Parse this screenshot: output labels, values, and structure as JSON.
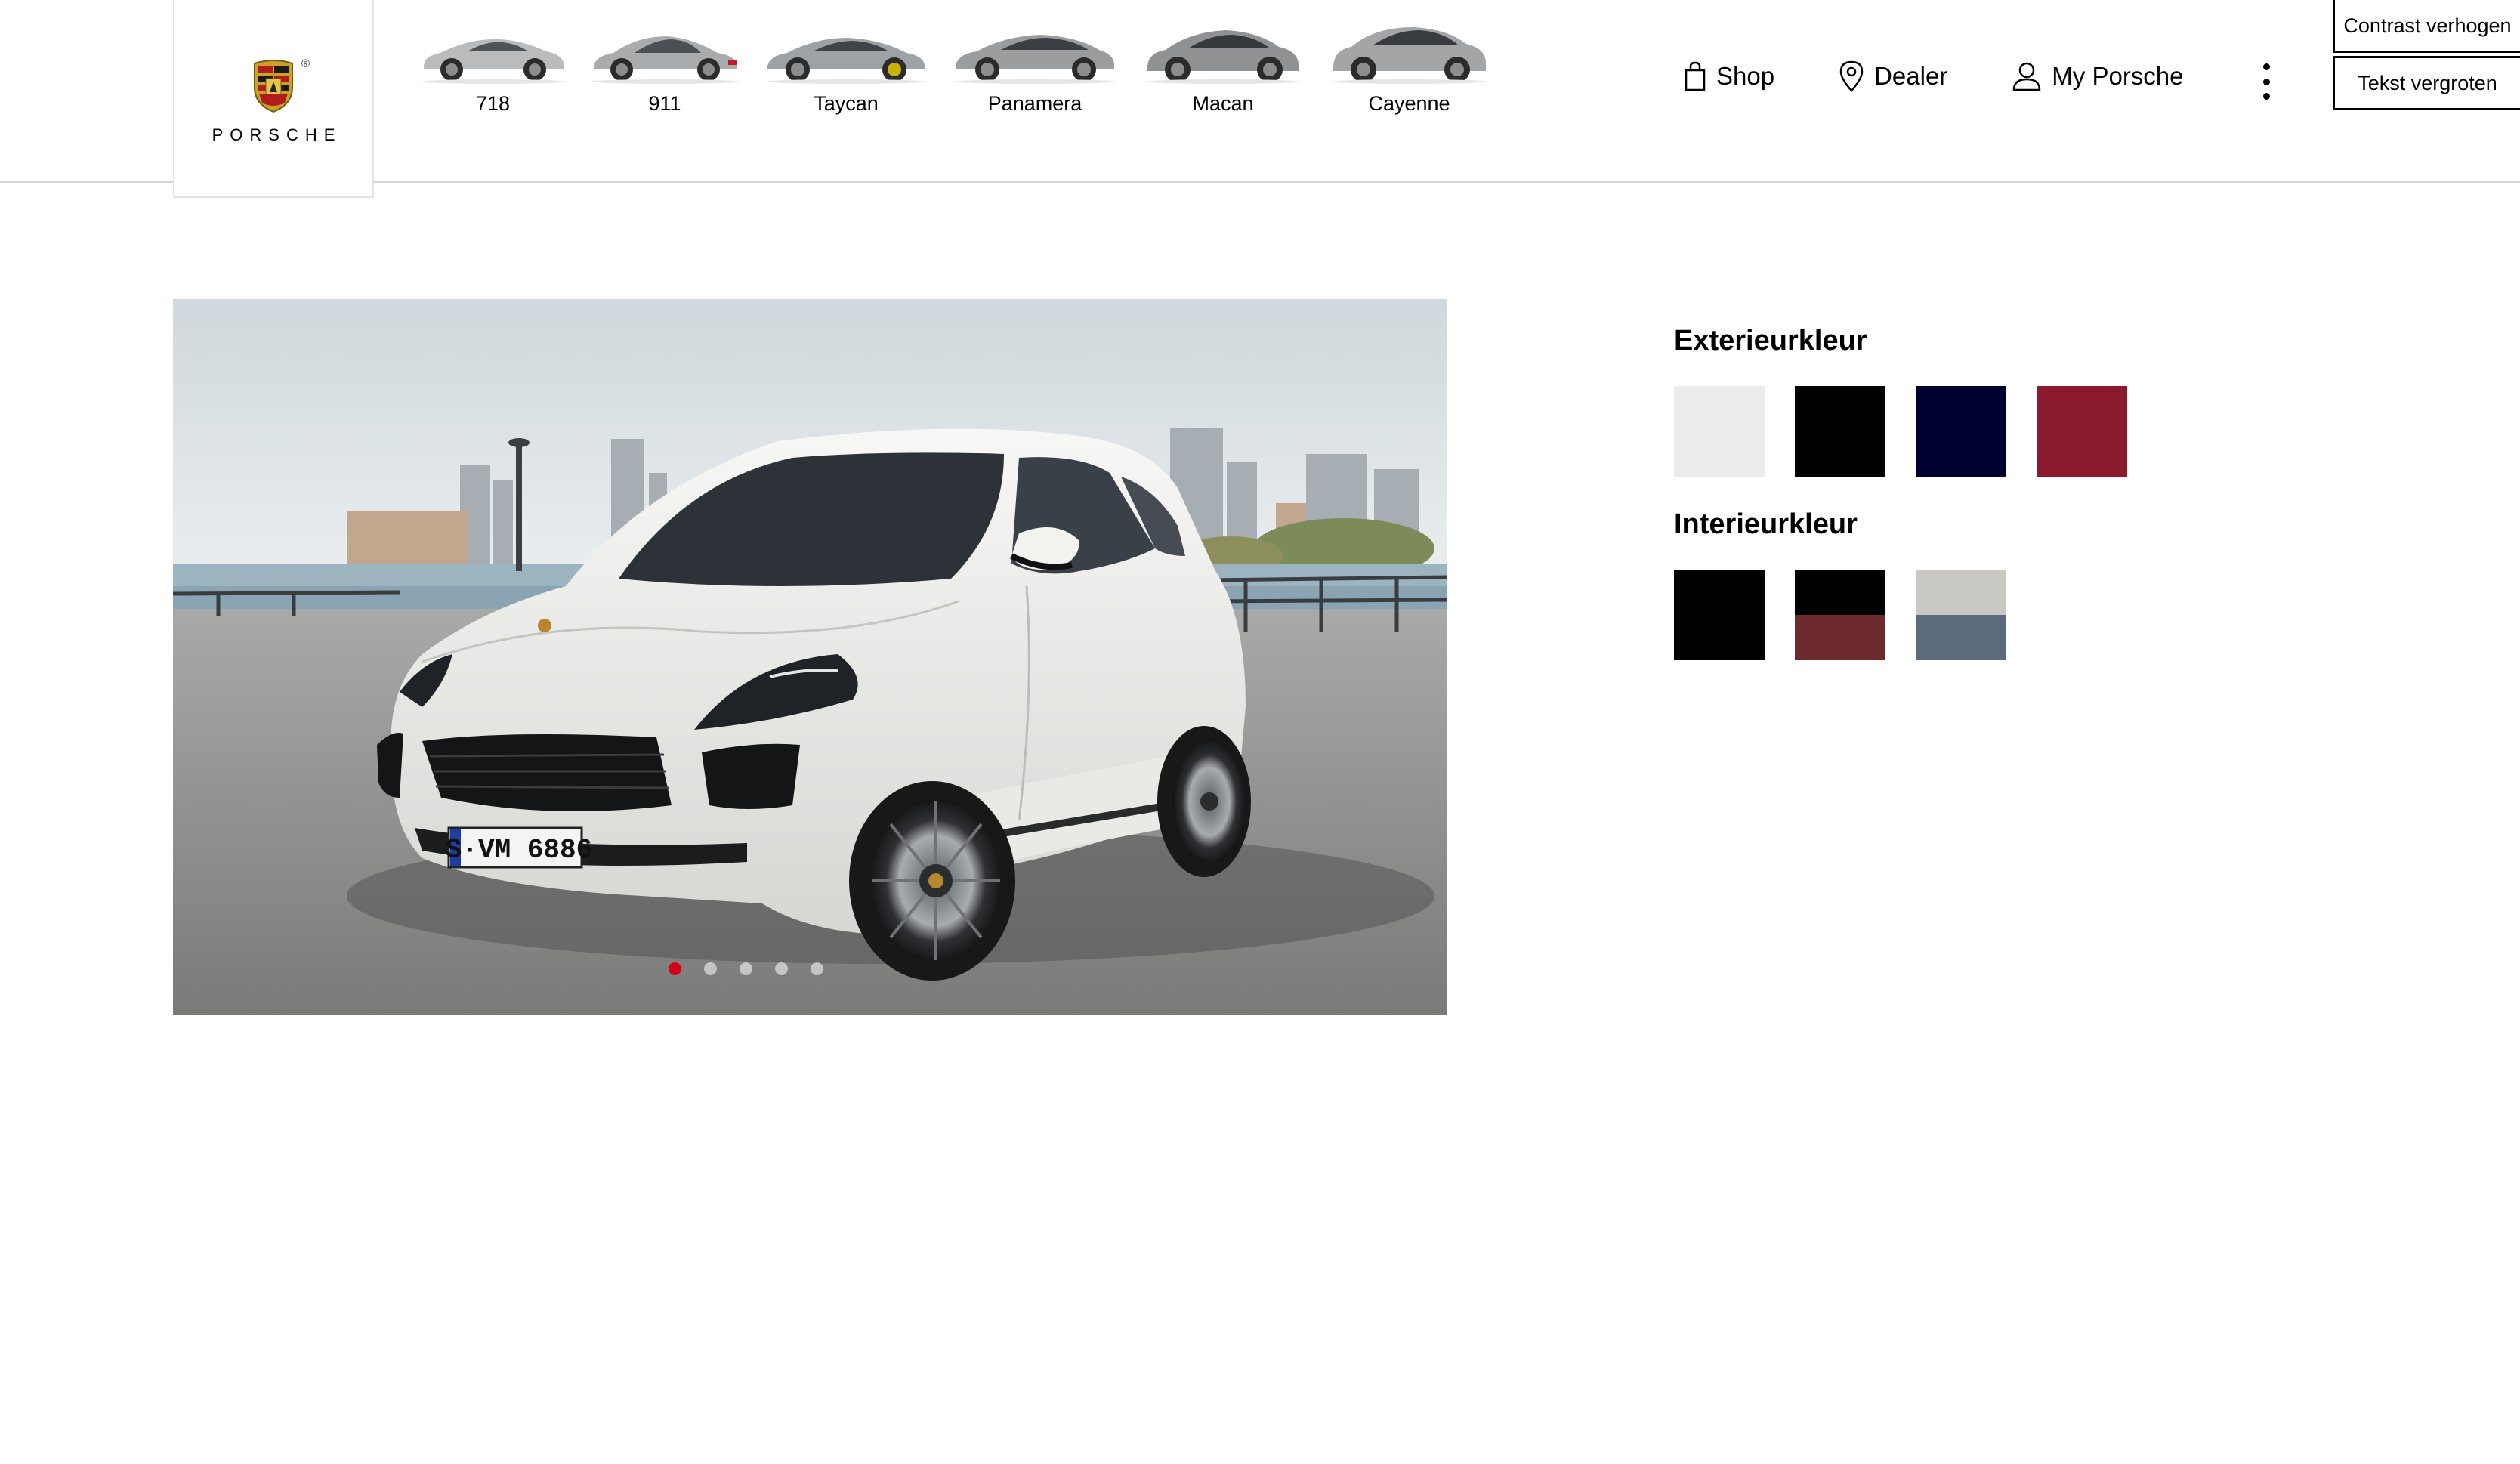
{
  "brand": {
    "wordmark": "PORSCHE",
    "registered_mark": "®"
  },
  "models": [
    {
      "label": "718",
      "icon": "car-718-icon"
    },
    {
      "label": "911",
      "icon": "car-911-icon"
    },
    {
      "label": "Taycan",
      "icon": "car-taycan-icon"
    },
    {
      "label": "Panamera",
      "icon": "car-panamera-icon"
    },
    {
      "label": "Macan",
      "icon": "car-macan-icon"
    },
    {
      "label": "Cayenne",
      "icon": "car-cayenne-icon"
    }
  ],
  "nav": {
    "shop": "Shop",
    "dealer": "Dealer",
    "my_porsche": "My Porsche",
    "more_icon": "more-vertical-icon"
  },
  "accessibility": {
    "contrast": "Contrast verhogen",
    "text_size": "Tekst vergroten"
  },
  "hero": {
    "license_plate": "S·VM 6886",
    "slides_total": 5,
    "active_slide": 1
  },
  "exterior": {
    "title": "Exterieurkleur",
    "colors": [
      "#ececec",
      "#000000",
      "#000030",
      "#8c1a2e"
    ]
  },
  "interior": {
    "title": "Interieurkleur",
    "colors": [
      {
        "top": "#000000",
        "bottom": "#000000"
      },
      {
        "top": "#000000",
        "bottom": "#6e2b2d"
      },
      {
        "top": "#c9c8c2",
        "bottom": "#5b6b7d"
      }
    ]
  },
  "colors": {
    "accent": "#d5001c",
    "divider": "#d5d5d5"
  }
}
